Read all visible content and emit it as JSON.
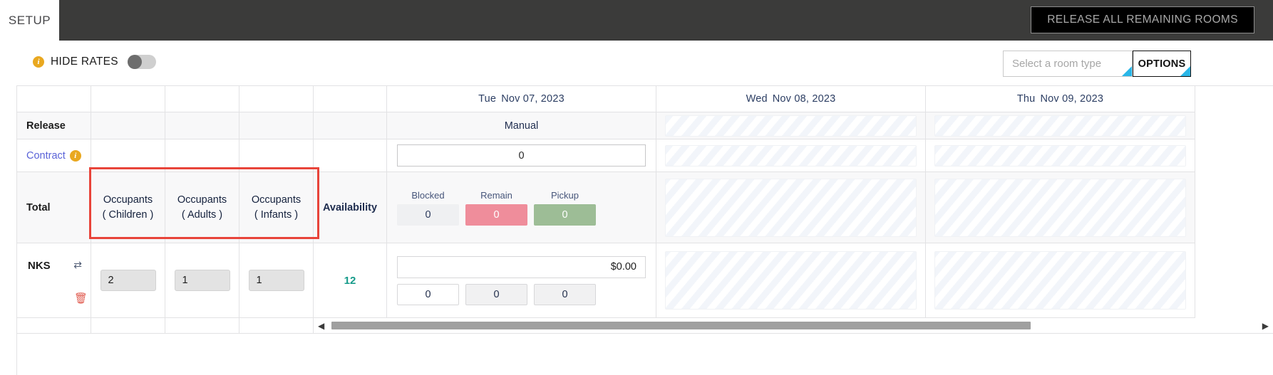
{
  "topbar": {
    "setup_label": "SETUP",
    "release_all_label": "RELEASE ALL REMAINING ROOMS"
  },
  "toolbar": {
    "hide_rates_label": "HIDE RATES",
    "info_glyph": "i",
    "room_type_placeholder": "Select a room type",
    "options_label": "OPTIONS"
  },
  "grid": {
    "days": [
      {
        "weekday": "Tue",
        "date": "Nov 07, 2023"
      },
      {
        "weekday": "Wed",
        "date": "Nov 08, 2023"
      },
      {
        "weekday": "Thu",
        "date": "Nov 09, 2023"
      }
    ],
    "rows": {
      "release": {
        "label": "Release",
        "day1_value": "Manual"
      },
      "contract": {
        "label": "Contract",
        "info_glyph": "i",
        "day1_value": "0"
      },
      "total": {
        "label": "Total",
        "occupants_children": "Occupants\n( Children )",
        "occupants_children_line1": "Occupants",
        "occupants_children_line2": "( Children )",
        "occupants_adults_line1": "Occupants",
        "occupants_adults_line2": "( Adults )",
        "occupants_infants_line1": "Occupants",
        "occupants_infants_line2": "( Infants )",
        "availability_label": "Availability",
        "blocked_caption": "Blocked",
        "blocked_value": "0",
        "remain_caption": "Remain",
        "remain_value": "0",
        "pickup_caption": "Pickup",
        "pickup_value": "0"
      },
      "nks": {
        "label": "NKS",
        "swap_glyph": "⇄",
        "trash_glyph": "🗑",
        "children_value": "2",
        "adults_value": "1",
        "infants_value": "1",
        "availability_value": "12",
        "price_value": "$0.00",
        "box1_value": "0",
        "box2_value": "0",
        "box3_value": "0"
      }
    }
  },
  "colors": {
    "accent_teal": "#169b8a",
    "remain_red": "#ef8d9b",
    "pickup_green": "#9dbd96",
    "highlight_red": "#e8443a",
    "link_blue": "#5a63d8",
    "info_amber": "#e9a820",
    "dropdown_corner": "#29b6e8"
  },
  "scrollbar": {
    "left_arrow": "◀",
    "right_arrow": "▶"
  }
}
